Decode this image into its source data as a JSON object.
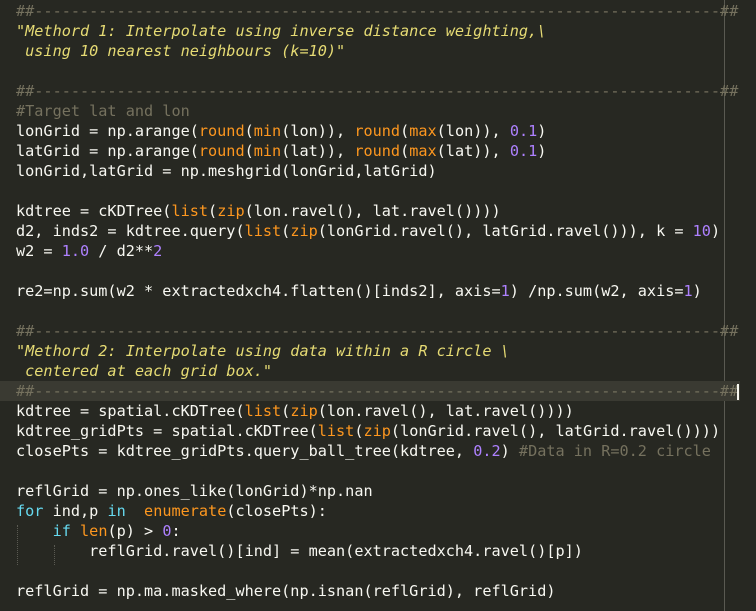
{
  "lines": [
    [
      {
        "t": "##---------------------------------------------------------------------------##",
        "c": "c"
      }
    ],
    [
      {
        "t": "\"Methord 1: Interpolate using inverse distance weighting,\\",
        "c": "s"
      }
    ],
    [
      {
        "t": " using 10 nearest neighbours (k=10)\"",
        "c": "s"
      }
    ],
    [],
    [
      {
        "t": "##---------------------------------------------------------------------------##",
        "c": "c"
      }
    ],
    [
      {
        "t": "#Target lat and lon",
        "c": "c"
      }
    ],
    [
      {
        "t": "lonGrid = np.arange(",
        "c": "p"
      },
      {
        "t": "round",
        "c": "bi"
      },
      {
        "t": "(",
        "c": "p"
      },
      {
        "t": "min",
        "c": "bi"
      },
      {
        "t": "(lon)), ",
        "c": "p"
      },
      {
        "t": "round",
        "c": "bi"
      },
      {
        "t": "(",
        "c": "p"
      },
      {
        "t": "max",
        "c": "bi"
      },
      {
        "t": "(lon)), ",
        "c": "p"
      },
      {
        "t": "0.1",
        "c": "n"
      },
      {
        "t": ")",
        "c": "p"
      }
    ],
    [
      {
        "t": "latGrid = np.arange(",
        "c": "p"
      },
      {
        "t": "round",
        "c": "bi"
      },
      {
        "t": "(",
        "c": "p"
      },
      {
        "t": "min",
        "c": "bi"
      },
      {
        "t": "(lat)), ",
        "c": "p"
      },
      {
        "t": "round",
        "c": "bi"
      },
      {
        "t": "(",
        "c": "p"
      },
      {
        "t": "max",
        "c": "bi"
      },
      {
        "t": "(lat)), ",
        "c": "p"
      },
      {
        "t": "0.1",
        "c": "n"
      },
      {
        "t": ")",
        "c": "p"
      }
    ],
    [
      {
        "t": "lonGrid,latGrid = np.meshgrid(lonGrid,latGrid)",
        "c": "p"
      }
    ],
    [],
    [
      {
        "t": "kdtree = cKDTree(",
        "c": "p"
      },
      {
        "t": "list",
        "c": "bi"
      },
      {
        "t": "(",
        "c": "p"
      },
      {
        "t": "zip",
        "c": "bi"
      },
      {
        "t": "(lon.ravel(), lat.ravel())))",
        "c": "p"
      }
    ],
    [
      {
        "t": "d2, inds2 = kdtree.query(",
        "c": "p"
      },
      {
        "t": "list",
        "c": "bi"
      },
      {
        "t": "(",
        "c": "p"
      },
      {
        "t": "zip",
        "c": "bi"
      },
      {
        "t": "(lonGrid.ravel(), latGrid.ravel())), k = ",
        "c": "p"
      },
      {
        "t": "10",
        "c": "n"
      },
      {
        "t": ")",
        "c": "p"
      }
    ],
    [
      {
        "t": "w2 = ",
        "c": "p"
      },
      {
        "t": "1.0",
        "c": "n"
      },
      {
        "t": " / d2**",
        "c": "p"
      },
      {
        "t": "2",
        "c": "n"
      }
    ],
    [],
    [
      {
        "t": "re2=np.sum(w2 * extractedxch4.flatten()[inds2], axis=",
        "c": "p"
      },
      {
        "t": "1",
        "c": "n"
      },
      {
        "t": ") /np.sum(w2, axis=",
        "c": "p"
      },
      {
        "t": "1",
        "c": "n"
      },
      {
        "t": ")",
        "c": "p"
      }
    ],
    [],
    [
      {
        "t": "##---------------------------------------------------------------------------##",
        "c": "c"
      }
    ],
    [
      {
        "t": "\"Methord 2: Interpolate using data within a R circle \\",
        "c": "s"
      }
    ],
    [
      {
        "t": " centered at each grid box.\"",
        "c": "s"
      }
    ],
    [
      {
        "t": "##---------------------------------------------------------------------------##",
        "c": "c"
      }
    ],
    [
      {
        "t": "kdtree = spatial.cKDTree(",
        "c": "p"
      },
      {
        "t": "list",
        "c": "bi"
      },
      {
        "t": "(",
        "c": "p"
      },
      {
        "t": "zip",
        "c": "bi"
      },
      {
        "t": "(lon.ravel(), lat.ravel())))",
        "c": "p"
      }
    ],
    [
      {
        "t": "kdtree_gridPts = spatial.cKDTree(",
        "c": "p"
      },
      {
        "t": "list",
        "c": "bi"
      },
      {
        "t": "(",
        "c": "p"
      },
      {
        "t": "zip",
        "c": "bi"
      },
      {
        "t": "(lonGrid.ravel(), latGrid.ravel())))",
        "c": "p"
      }
    ],
    [
      {
        "t": "closePts = kdtree_gridPts.query_ball_tree(kdtree, ",
        "c": "p"
      },
      {
        "t": "0.2",
        "c": "n"
      },
      {
        "t": ") ",
        "c": "p"
      },
      {
        "t": "#Data in R=0.2 circle",
        "c": "c"
      }
    ],
    [],
    [
      {
        "t": "reflGrid = np.ones_like(lonGrid)*np.nan",
        "c": "p"
      }
    ],
    [
      {
        "t": "for",
        "c": "k"
      },
      {
        "t": " ind,p ",
        "c": "p"
      },
      {
        "t": "in",
        "c": "k"
      },
      {
        "t": "  ",
        "c": "p"
      },
      {
        "t": "enumerate",
        "c": "bi"
      },
      {
        "t": "(closePts):",
        "c": "p"
      }
    ],
    [
      {
        "t": "    ",
        "c": "p"
      },
      {
        "t": "if",
        "c": "k"
      },
      {
        "t": " ",
        "c": "p"
      },
      {
        "t": "len",
        "c": "bi"
      },
      {
        "t": "(p) > ",
        "c": "p"
      },
      {
        "t": "0",
        "c": "n"
      },
      {
        "t": ":",
        "c": "p"
      }
    ],
    [
      {
        "t": "        reflGrid.ravel()[ind] = mean(extractedxch4.ravel()[p])",
        "c": "p"
      }
    ],
    [],
    [
      {
        "t": "reflGrid = np.ma.masked_where(np.isnan(reflGrid), reflGrid)",
        "c": "p"
      }
    ]
  ],
  "current_line": 19
}
